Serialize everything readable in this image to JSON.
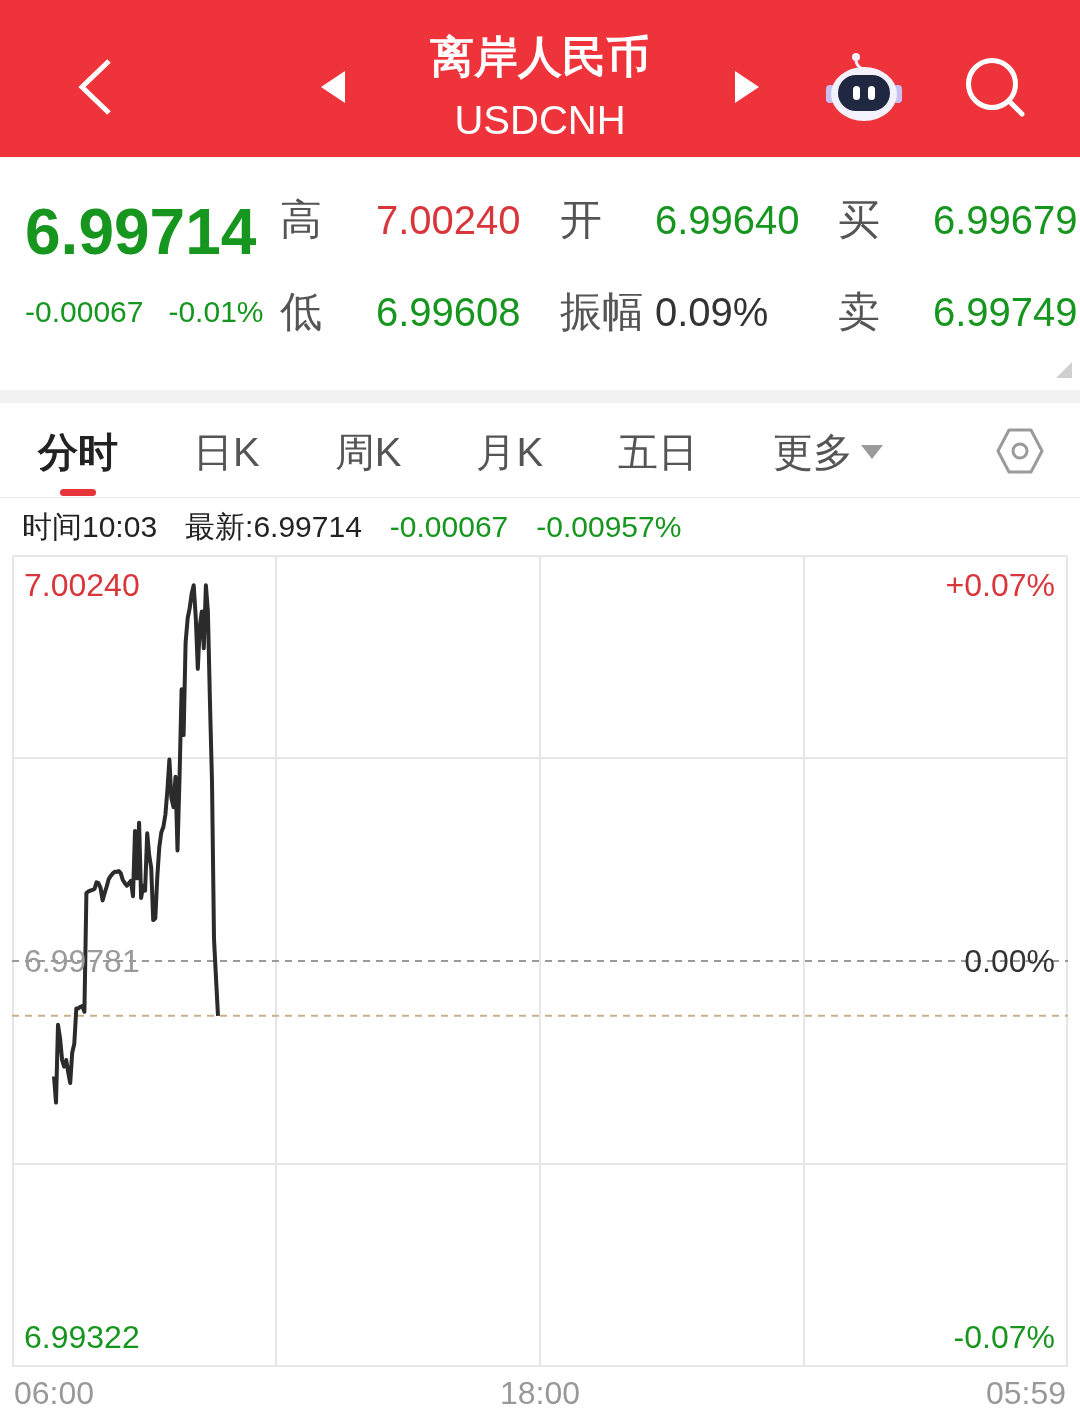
{
  "header": {
    "title": "离岸人民币",
    "subtitle": "USDCNH"
  },
  "quote": {
    "price": "6.99714",
    "change": "-0.00067",
    "change_percent": "-0.01%",
    "color": "#17961f",
    "fields": [
      {
        "label": "高",
        "value": "7.00240",
        "color": "#d8363b"
      },
      {
        "label": "开",
        "value": "6.99640",
        "color": "#17961f"
      },
      {
        "label": "买",
        "value": "6.99679",
        "color": "#17961f"
      },
      {
        "label": "低",
        "value": "6.99608",
        "color": "#17961f"
      },
      {
        "label": "振幅",
        "value": "0.09%",
        "color": "#333333"
      },
      {
        "label": "卖",
        "value": "6.99749",
        "color": "#17961f"
      }
    ]
  },
  "tabs": [
    {
      "label": "分时",
      "selected": true,
      "kind": "tab"
    },
    {
      "label": "日K",
      "selected": false,
      "kind": "tab"
    },
    {
      "label": "周K",
      "selected": false,
      "kind": "tab"
    },
    {
      "label": "月K",
      "selected": false,
      "kind": "tab"
    },
    {
      "label": "五日",
      "selected": false,
      "kind": "tab"
    },
    {
      "label": "更多",
      "selected": false,
      "kind": "menu"
    }
  ],
  "info_bar": [
    {
      "text": "时间10:03",
      "color": "#222222"
    },
    {
      "text": "最新:6.99714",
      "color": "#222222"
    },
    {
      "text": "-0.00067",
      "color": "#17961f"
    },
    {
      "text": "-0.00957%",
      "color": "#17961f"
    }
  ],
  "chart": {
    "right_axis_labels": [
      "+0.07%",
      "0.00%",
      "-0.07%"
    ],
    "chart_data": {
      "type": "line",
      "categories": [
        "06:00",
        null,
        null,
        null,
        null,
        null,
        null,
        null,
        null,
        null,
        null,
        null,
        null,
        null,
        null,
        null,
        null,
        null,
        null,
        null,
        null,
        null,
        null,
        null,
        null,
        null,
        null,
        null,
        null,
        null,
        null,
        null,
        null,
        null,
        null,
        null,
        null,
        null,
        null,
        null,
        null,
        null,
        null,
        null,
        null,
        null,
        null,
        null,
        null,
        null,
        null,
        null,
        null,
        null,
        null,
        null,
        null,
        null,
        null,
        null,
        null,
        null,
        null,
        null,
        null,
        null,
        null,
        null,
        null,
        null,
        null,
        null,
        null,
        null,
        null,
        null,
        null,
        null,
        null,
        null,
        null,
        null,
        null,
        null,
        null,
        null,
        null,
        null,
        null,
        null,
        null,
        null,
        null,
        null,
        null,
        null,
        null,
        null,
        null,
        null,
        null,
        null,
        null,
        null,
        null,
        null,
        null,
        null,
        null,
        null,
        null,
        null,
        null,
        null,
        null,
        null,
        null,
        null,
        null,
        null,
        null,
        null,
        null,
        null,
        null,
        null,
        null,
        null,
        null,
        null,
        null,
        null,
        null,
        null,
        null,
        null,
        null,
        null,
        null,
        null,
        null,
        null,
        null,
        null,
        null,
        null,
        null,
        null,
        null,
        null,
        null,
        null,
        null,
        null,
        null,
        null,
        null,
        null,
        null,
        null,
        null,
        null,
        null,
        null,
        null,
        null,
        null,
        null,
        null,
        null,
        null,
        null,
        null,
        null,
        null,
        null,
        null,
        null,
        null,
        null,
        null,
        null,
        null,
        null,
        null,
        null,
        null,
        null,
        null,
        null,
        null,
        null,
        null,
        null,
        null,
        null,
        null,
        null,
        null,
        null,
        null,
        null,
        null,
        null,
        null,
        null,
        null,
        null,
        null,
        null,
        null,
        null,
        null,
        null,
        null,
        null,
        null,
        null,
        null,
        null,
        null,
        null,
        null,
        null,
        null,
        null,
        null,
        null,
        null,
        null,
        null,
        null,
        null,
        null,
        null,
        null,
        null,
        null,
        null,
        null,
        "18:00",
        null,
        null,
        null,
        null,
        null,
        null,
        null,
        null,
        null,
        null,
        null,
        null,
        null,
        null,
        null,
        null,
        null,
        null,
        null,
        null,
        null,
        null,
        null,
        null,
        null,
        null,
        null,
        null,
        null,
        null,
        null,
        null,
        null,
        null,
        null,
        null,
        null,
        null,
        null,
        null,
        null,
        null,
        null,
        null,
        null,
        null,
        null,
        null,
        null,
        null,
        null,
        null,
        null,
        null,
        null,
        null,
        null,
        null,
        null,
        null,
        null,
        null,
        null,
        null,
        null,
        null,
        null,
        null,
        null,
        null,
        null,
        null,
        null,
        null,
        null,
        null,
        null,
        null,
        null,
        null,
        null,
        null,
        null,
        null,
        null,
        null,
        null,
        null,
        null,
        null,
        null,
        null,
        null,
        null,
        null,
        null,
        null,
        null,
        null,
        null,
        null,
        null,
        null,
        null,
        null,
        null,
        null,
        null,
        null,
        null,
        null,
        null,
        null,
        null,
        null,
        null,
        null,
        null,
        null,
        null,
        null,
        null,
        null,
        null,
        null,
        null,
        null,
        null,
        null,
        null,
        null,
        null,
        null,
        null,
        null,
        null,
        null,
        null,
        null,
        null,
        null,
        null,
        null,
        null,
        null,
        null,
        null,
        null,
        null,
        null,
        null,
        null,
        null,
        null,
        null,
        null,
        null,
        null,
        null,
        null,
        null,
        null,
        null,
        null,
        null,
        null,
        null,
        null,
        null,
        null,
        null,
        null,
        null,
        null,
        null,
        null,
        null,
        null,
        null,
        null,
        null,
        null,
        null,
        null,
        null,
        null,
        null,
        null,
        null,
        null,
        null,
        null,
        null,
        null,
        null,
        null,
        null,
        null,
        null,
        null,
        null,
        null,
        null,
        null,
        null,
        null,
        null,
        null,
        null,
        null,
        null,
        null,
        null,
        null,
        null,
        null,
        null,
        null,
        null,
        null,
        null,
        null,
        null,
        null,
        null,
        null,
        null,
        null,
        null,
        null,
        null,
        null,
        null,
        null,
        null,
        null,
        null,
        null,
        null,
        "05:59"
      ],
      "values": [
        6.9964,
        6.99608,
        6.99703,
        6.99686,
        6.9966,
        6.99652,
        6.9966,
        6.99645,
        6.99632,
        6.99669,
        6.9968,
        6.99723,
        6.99723,
        6.99725,
        6.99726,
        6.99719,
        6.99864,
        6.99866,
        6.99867,
        6.99868,
        6.99869,
        6.99877,
        6.99876,
        6.9987,
        6.99855,
        6.99864,
        6.99872,
        6.99881,
        6.99885,
        6.99888,
        6.9989,
        6.9989,
        6.99891,
        6.99888,
        6.9988,
        6.99876,
        6.99873,
        6.99876,
        6.99879,
        6.9986,
        6.9994,
        6.99882,
        6.9995,
        6.99858,
        6.99873,
        6.99867,
        6.99937,
        6.9991,
        6.99895,
        6.99831,
        6.99833,
        6.99884,
        6.9992,
        6.99938,
        6.99945,
        6.9996,
        6.9999,
        7.00027,
        6.9998,
        6.99969,
        7.00006,
        6.99916,
        7.00008,
        7.00113,
        7.00057,
        7.0017,
        7.002,
        7.00212,
        7.0023,
        7.0024,
        7.002,
        7.00138,
        7.0019,
        7.00208,
        7.00163,
        7.0024,
        7.00208,
        7.001,
        7.0,
        6.99808,
        6.9976,
        6.99714,
        null,
        null,
        null,
        null,
        null,
        null,
        null,
        null,
        null,
        null,
        null,
        null,
        null,
        null,
        null,
        null,
        null,
        null,
        null,
        null,
        null,
        null,
        null,
        null,
        null,
        null,
        null,
        null,
        null,
        null,
        null,
        null,
        null,
        null,
        null,
        null,
        null,
        null,
        null,
        null,
        null,
        null,
        null,
        null,
        null,
        null,
        null,
        null,
        null,
        null,
        null,
        null,
        null,
        null,
        null,
        null,
        null,
        null,
        null,
        null,
        null,
        null,
        null,
        null,
        null,
        null,
        null,
        null,
        null,
        null,
        null,
        null,
        null,
        null,
        null,
        null,
        null,
        null,
        null,
        null,
        null,
        null,
        null,
        null,
        null,
        null,
        null,
        null,
        null,
        null,
        null,
        null,
        null,
        null,
        null,
        null,
        null,
        null,
        null,
        null,
        null,
        null,
        null,
        null,
        null,
        null,
        null,
        null,
        null,
        null,
        null,
        null,
        null,
        null,
        null,
        null,
        null,
        null,
        null,
        null,
        null,
        null,
        null,
        null,
        null,
        null,
        null,
        null,
        null,
        null,
        null,
        null,
        null,
        null,
        null,
        null,
        null,
        null,
        null,
        null,
        null,
        null,
        null,
        null,
        null,
        null,
        null,
        null,
        null,
        null,
        null,
        null,
        null,
        null,
        null,
        null,
        null,
        null,
        null,
        null,
        null,
        null,
        null,
        null,
        null,
        null,
        null,
        null,
        null,
        null,
        null,
        null,
        null,
        null,
        null,
        null,
        null,
        null,
        null,
        null,
        null,
        null,
        null,
        null,
        null,
        null,
        null,
        null,
        null,
        null,
        null,
        null,
        null,
        null,
        null,
        null,
        null,
        null,
        null,
        null,
        null,
        null,
        null,
        null,
        null,
        null,
        null,
        null,
        null,
        null,
        null,
        null,
        null,
        null,
        null,
        null,
        null,
        null,
        null,
        null,
        null,
        null,
        null,
        null,
        null,
        null,
        null,
        null,
        null,
        null,
        null,
        null,
        null,
        null,
        null,
        null,
        null,
        null,
        null,
        null,
        null,
        null,
        null,
        null,
        null,
        null,
        null,
        null,
        null,
        null,
        null,
        null,
        null,
        null,
        null,
        null,
        null,
        null,
        null,
        null,
        null,
        null,
        null,
        null,
        null,
        null,
        null,
        null,
        null,
        null,
        null,
        null,
        null,
        null,
        null,
        null,
        null,
        null,
        null,
        null,
        null,
        null,
        null,
        null,
        null,
        null,
        null,
        null,
        null,
        null,
        null,
        null,
        null,
        null,
        null,
        null,
        null,
        null,
        null,
        null,
        null,
        null,
        null,
        null,
        null,
        null,
        null,
        null,
        null,
        null,
        null,
        null,
        null,
        null,
        null,
        null,
        null,
        null,
        null,
        null,
        null,
        null,
        null,
        null,
        null,
        null,
        null,
        null,
        null,
        null,
        null,
        null,
        null,
        null,
        null,
        null,
        null,
        null,
        null,
        null,
        null,
        null,
        null,
        null,
        null,
        null,
        null,
        null,
        null,
        null,
        null,
        null,
        null,
        null,
        null,
        null,
        null,
        null,
        null,
        null,
        null,
        null,
        null,
        null,
        null,
        null,
        null,
        null,
        null,
        null,
        null,
        null,
        null,
        null,
        null,
        null,
        null,
        null,
        null,
        null,
        null,
        null,
        null,
        null,
        null,
        null,
        null,
        null,
        null,
        null,
        null,
        null,
        null,
        null,
        null,
        null,
        null,
        null,
        null
      ],
      "ylim": [
        6.99285,
        7.00277
      ],
      "yticks": [
        {
          "value": 6.99322,
          "label": "6.99322"
        },
        {
          "value": 6.99781,
          "label": "6.99781"
        },
        {
          "value": 7.0024,
          "label": "7.00240"
        }
      ],
      "ref_lines": [
        {
          "axis": "y",
          "value": 6.99781,
          "color": "#9a9a9a"
        },
        {
          "axis": "y",
          "value": 6.99714,
          "color": "#c8b08a"
        }
      ]
    }
  }
}
